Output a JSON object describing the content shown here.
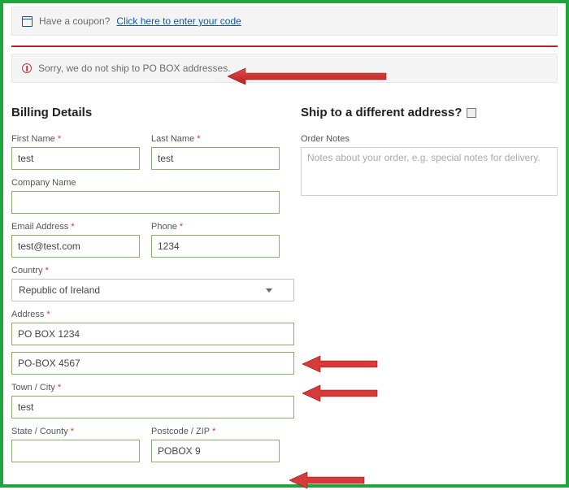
{
  "coupon": {
    "prompt": "Have a coupon?",
    "link_text": "Click here to enter your code"
  },
  "error": {
    "message": "Sorry, we do not ship to PO BOX addresses."
  },
  "billing": {
    "heading": "Billing Details",
    "first_name": {
      "label": "First Name",
      "value": "test"
    },
    "last_name": {
      "label": "Last Name",
      "value": "test"
    },
    "company": {
      "label": "Company Name",
      "value": ""
    },
    "email": {
      "label": "Email Address",
      "value": "test@test.com"
    },
    "phone": {
      "label": "Phone",
      "value": "1234"
    },
    "country": {
      "label": "Country",
      "value": "Republic of Ireland"
    },
    "address": {
      "label": "Address",
      "line1": "PO BOX 1234",
      "line2": "PO-BOX 4567"
    },
    "city": {
      "label": "Town / City",
      "value": "test"
    },
    "state": {
      "label": "State / County",
      "value": ""
    },
    "postcode": {
      "label": "Postcode / ZIP",
      "value": "POBOX 9"
    }
  },
  "shipping": {
    "heading": "Ship to a different address?",
    "notes_label": "Order Notes",
    "notes_placeholder": "Notes about your order, e.g. special notes for delivery."
  }
}
